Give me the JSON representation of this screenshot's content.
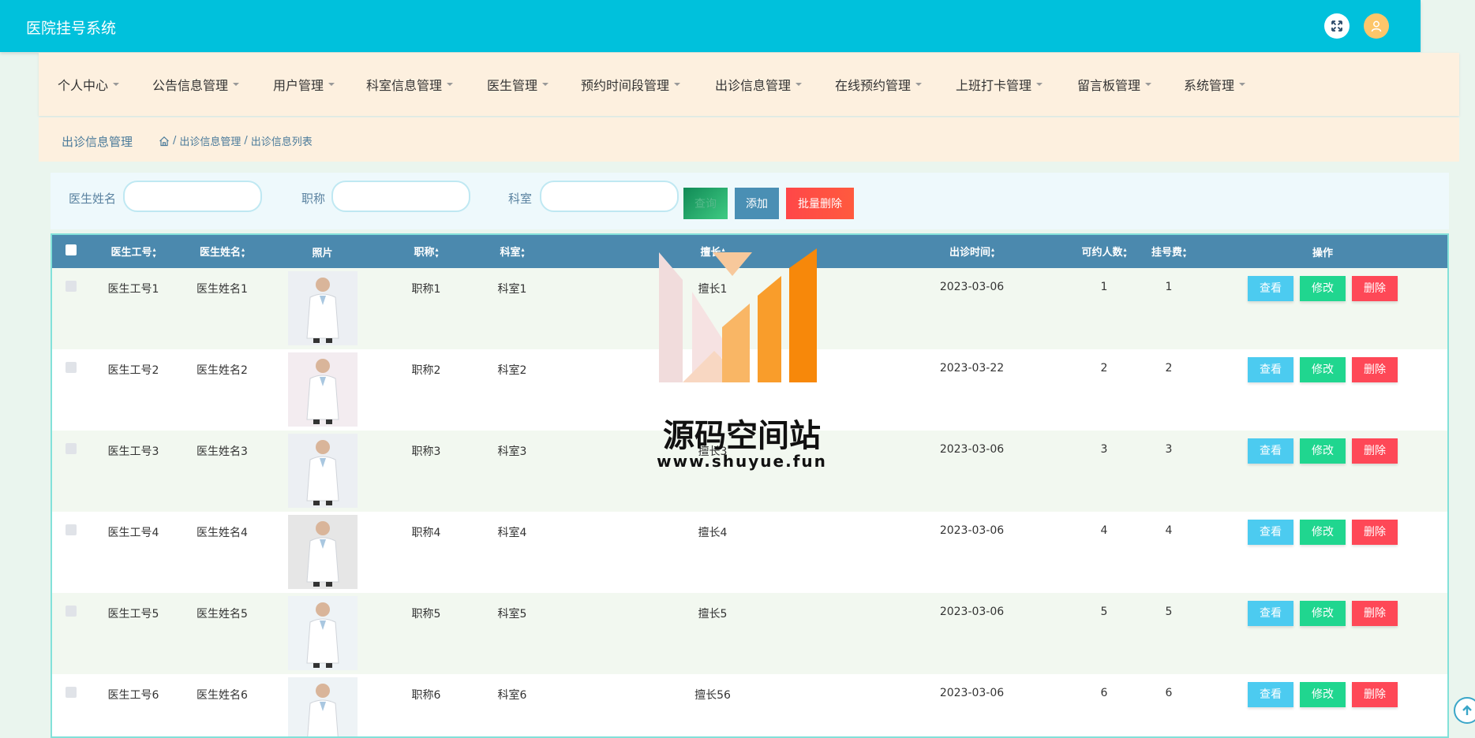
{
  "header": {
    "title": "医院挂号系统"
  },
  "icons": {
    "fullscreen": "fullscreen-icon",
    "user": "user-icon",
    "home": "home-icon",
    "scroll_top": "arrow-up-icon"
  },
  "colors": {
    "topbar": "#00c1dc",
    "table_header": "#4b89ae",
    "view": "#4ccbf0",
    "edit": "#20d68f",
    "delete": "#fe4857"
  },
  "nav": [
    "个人中心",
    "公告信息管理",
    "用户管理",
    "科室信息管理",
    "医生管理",
    "预约时间段管理",
    "出诊信息管理",
    "在线预约管理",
    "上班打卡管理",
    "留言板管理",
    "系统管理"
  ],
  "breadcrumb": {
    "title": "出诊信息管理",
    "sep1": "/",
    "item1": "出诊信息管理",
    "sep2": "/",
    "item2": "出诊信息列表"
  },
  "search": {
    "doctor_name_label": "医生姓名",
    "doctor_name_value": "",
    "title_label": "职称",
    "title_value": "",
    "dept_label": "科室",
    "dept_value": "",
    "search_button": "查询",
    "add_button": "添加",
    "batch_delete_button": "批量删除"
  },
  "table": {
    "headers": [
      "医生工号",
      "医生姓名",
      "照片",
      "职称",
      "科室",
      "擅长",
      "出诊时间",
      "可约人数",
      "挂号费",
      "操作"
    ],
    "actions": {
      "view": "查看",
      "edit": "修改",
      "delete": "删除"
    },
    "rows": [
      {
        "id": "医生工号1",
        "name": "医生姓名1",
        "title": "职称1",
        "dept": "科室1",
        "specialty": "擅长1",
        "date": "2023-03-06",
        "quota": "1",
        "fee": "1"
      },
      {
        "id": "医生工号2",
        "name": "医生姓名2",
        "title": "职称2",
        "dept": "科室2",
        "specialty": "擅长2",
        "date": "2023-03-22",
        "quota": "2",
        "fee": "2"
      },
      {
        "id": "医生工号3",
        "name": "医生姓名3",
        "title": "职称3",
        "dept": "科室3",
        "specialty": "擅长3",
        "date": "2023-03-06",
        "quota": "3",
        "fee": "3"
      },
      {
        "id": "医生工号4",
        "name": "医生姓名4",
        "title": "职称4",
        "dept": "科室4",
        "specialty": "擅长4",
        "date": "2023-03-06",
        "quota": "4",
        "fee": "4"
      },
      {
        "id": "医生工号5",
        "name": "医生姓名5",
        "title": "职称5",
        "dept": "科室5",
        "specialty": "擅长5",
        "date": "2023-03-06",
        "quota": "5",
        "fee": "5"
      },
      {
        "id": "医生工号6",
        "name": "医生姓名6",
        "title": "职称6",
        "dept": "科室6",
        "specialty": "擅长56",
        "date": "2023-03-06",
        "quota": "6",
        "fee": "6"
      }
    ]
  },
  "watermark": {
    "text": "源码空间站",
    "url": "www.shuyue.fun"
  }
}
